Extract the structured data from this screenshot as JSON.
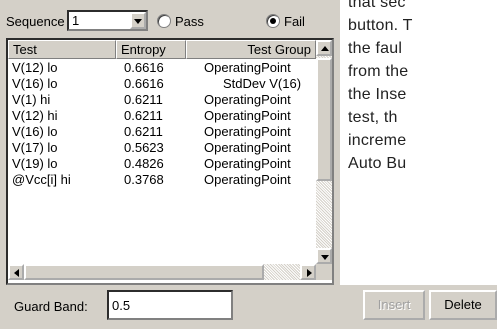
{
  "sequence": {
    "label": "Sequence",
    "value": "1"
  },
  "result_radios": [
    {
      "label": "Pass",
      "selected": false
    },
    {
      "label": "Fail",
      "selected": true
    }
  ],
  "table": {
    "columns": [
      "Test",
      "Entropy",
      "Test Group"
    ],
    "rows": [
      [
        "V(12) lo",
        "0.6616",
        "OperatingPoint"
      ],
      [
        "V(16) lo",
        "0.6616",
        "StdDev V(16)"
      ],
      [
        "V(1) hi",
        "0.6211",
        "OperatingPoint"
      ],
      [
        "V(12) hi",
        "0.6211",
        "OperatingPoint"
      ],
      [
        "V(16) lo",
        "0.6211",
        "OperatingPoint"
      ],
      [
        "V(17) lo",
        "0.5623",
        "OperatingPoint"
      ],
      [
        "V(19) lo",
        "0.4826",
        "OperatingPoint"
      ],
      [
        "@Vcc[i] hi",
        "0.3768",
        "OperatingPoint"
      ]
    ]
  },
  "guard_band": {
    "label": "Guard Band:",
    "value": "0.5"
  },
  "buttons": {
    "insert": "Insert",
    "delete": "Delete"
  },
  "doc_text": [
    "that sec",
    "button. T",
    "the faul",
    "from the",
    "the Inse",
    "test, th",
    "increme",
    "Auto Bu"
  ]
}
